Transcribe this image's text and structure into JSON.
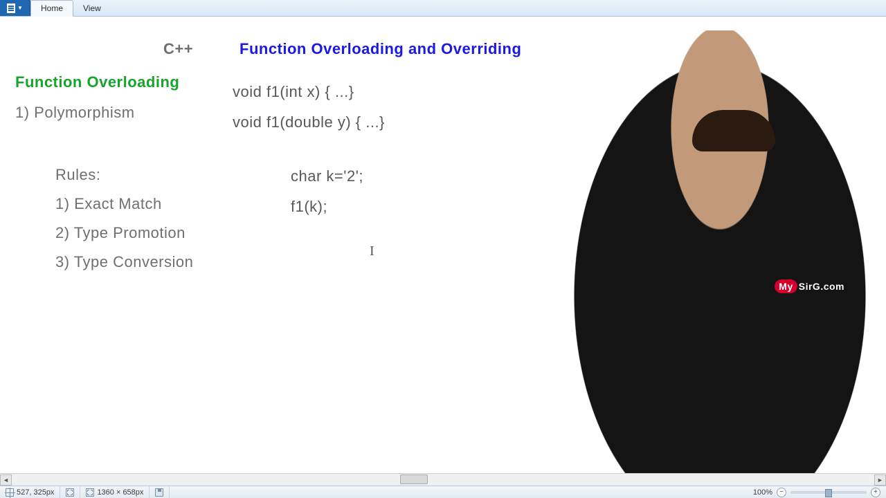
{
  "ribbon": {
    "tabs": [
      "Home",
      "View"
    ]
  },
  "content": {
    "language": "C++",
    "title": "Function Overloading and Overriding",
    "section_heading": "Function Overloading",
    "point1": "1) Polymorphism",
    "code_line1": "void f1(int x) { ...}",
    "code_line2": "void f1(double y) { ...}",
    "rules_heading": "Rules:",
    "rules": [
      "1) Exact Match",
      "2) Type Promotion",
      "3) Type Conversion"
    ],
    "code_line3": "char k='2';",
    "code_line4": "f1(k);",
    "logo_prefix": "My",
    "logo_suffix": "SirG.com"
  },
  "statusbar": {
    "cursor_pos": "527, 325px",
    "canvas_dims": "1360 × 658px",
    "zoom_label": "100%"
  }
}
